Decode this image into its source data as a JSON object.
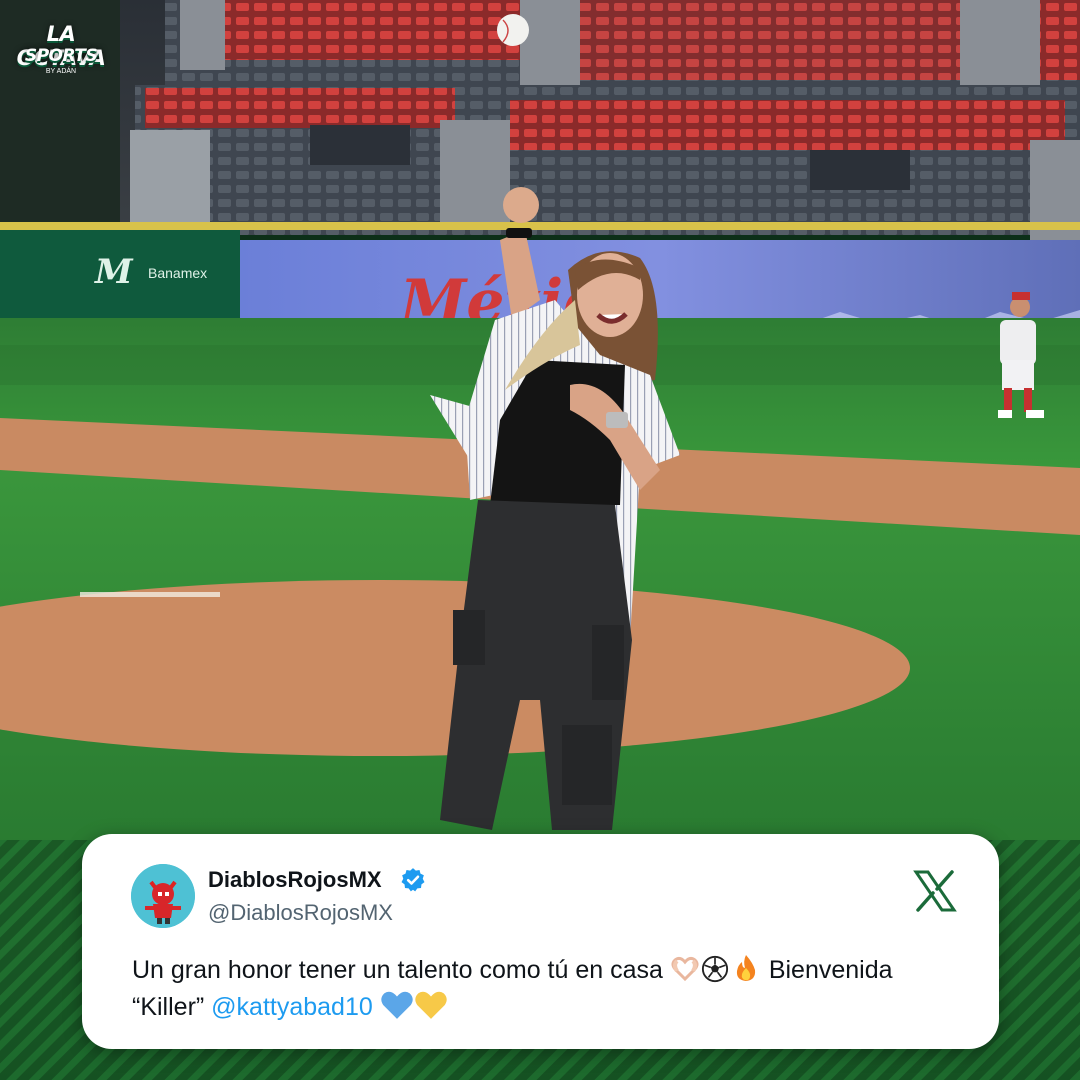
{
  "brand": {
    "logo_line1": "LA OCTAVA",
    "logo_line2": "SPORTS",
    "logo_small": "BY ADÁN"
  },
  "photo": {
    "signage_text": "México",
    "background_logo": "M"
  },
  "post": {
    "display_name": "DiablosRojosMX",
    "handle": "@DiablosRojosMX",
    "text_part1": "Un gran honor tener un talento como tú en casa",
    "text_part2": "Bienvenida",
    "text_part3": "“Killer”",
    "mention": "@kattyabad10",
    "platform_icon": "x-icon",
    "avatar_icon": "red-devil-mascot-icon",
    "verified_icon": "verified-badge-icon",
    "emojis": [
      "heart-hands-icon",
      "soccer-ball-icon",
      "fire-icon",
      "blue-heart-icon",
      "yellow-heart-icon"
    ]
  },
  "colors": {
    "mention": "#1d9bf0",
    "verified": "#1d9bf0",
    "x_logo": "#1b6b3a",
    "field_green": "#2f8f3a",
    "dirt": "#c98a62",
    "seats_red": "#c33a3a"
  }
}
